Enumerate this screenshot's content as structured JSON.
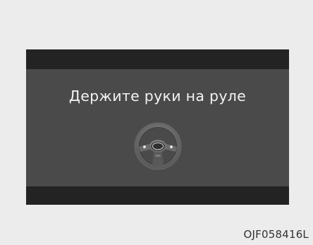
{
  "display": {
    "message": "Держите руки на руле",
    "icon": "steering-wheel-icon"
  },
  "figure": {
    "code": "OJF058416L"
  },
  "colors": {
    "page_background": "#ececec",
    "display_background": "#4a4a4a",
    "display_bars": "#232323",
    "message_text": "#f2f2f2",
    "code_text": "#333333"
  }
}
